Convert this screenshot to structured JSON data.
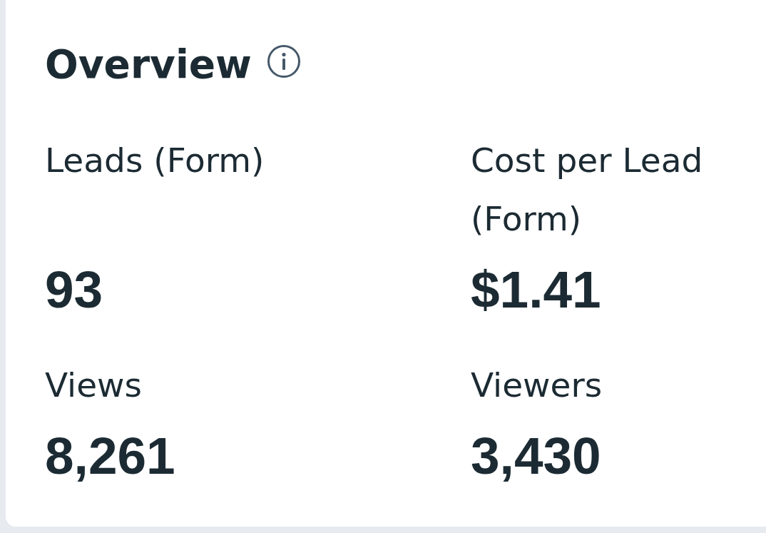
{
  "card": {
    "title": "Overview",
    "stats": [
      {
        "label": "Leads (Form)",
        "value": "93"
      },
      {
        "label": "Cost per Lead (Form)",
        "value": "$1.41"
      },
      {
        "label": "Views",
        "value": "8,261"
      },
      {
        "label": "Viewers",
        "value": "3,430"
      }
    ]
  }
}
